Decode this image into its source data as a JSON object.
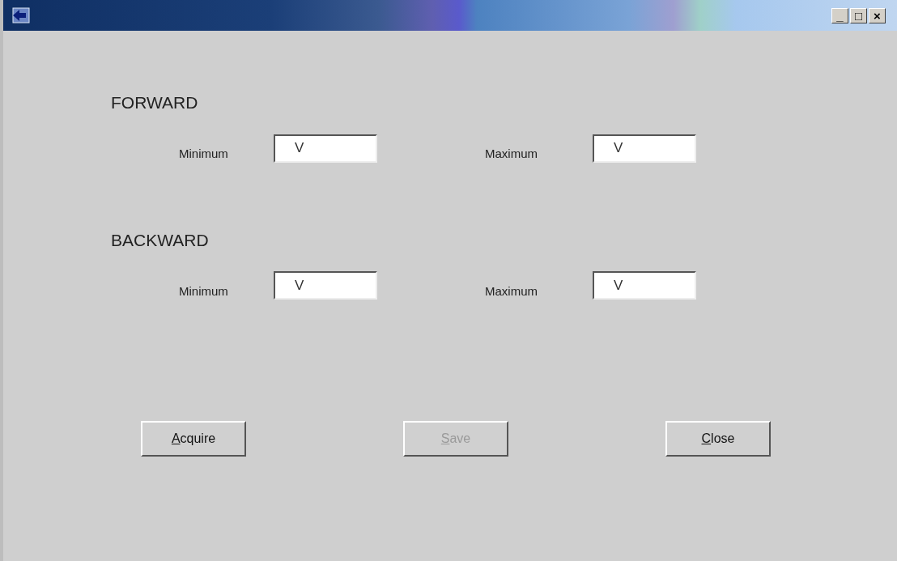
{
  "window": {
    "controls": [
      "_",
      "□",
      "×"
    ]
  },
  "sections": [
    {
      "title": "FORWARD",
      "fields": [
        {
          "label": "Minimum",
          "value": "V"
        },
        {
          "label": "Maximum",
          "value": "V"
        }
      ]
    },
    {
      "title": "BACKWARD",
      "fields": [
        {
          "label": "Minimum",
          "value": "V"
        },
        {
          "label": "Maximum",
          "value": "V"
        }
      ]
    }
  ],
  "buttons": [
    {
      "mnemonic": "A",
      "rest": "cquire",
      "disabled": false
    },
    {
      "mnemonic": "S",
      "rest": "ave",
      "disabled": true
    },
    {
      "mnemonic": "C",
      "rest": "lose",
      "disabled": false
    }
  ]
}
